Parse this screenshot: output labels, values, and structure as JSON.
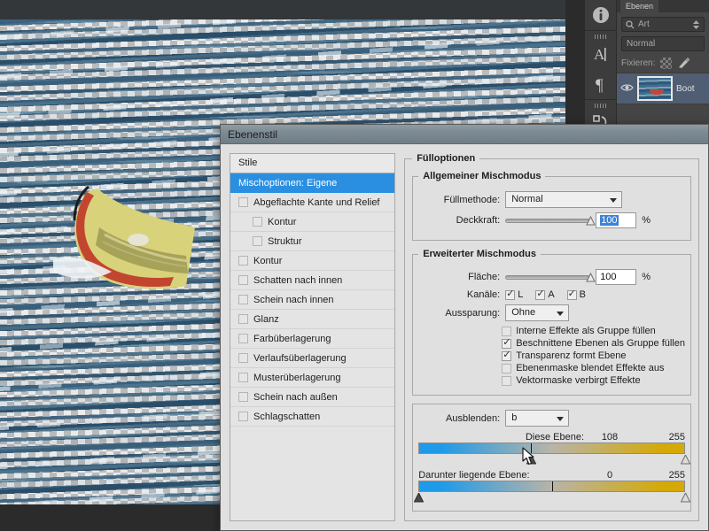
{
  "app": {
    "dock": {
      "panel_tab_label": "Ebenen",
      "search_placeholder": "Art",
      "blend_mode_value": "Normal",
      "lock_label": "Fixieren:",
      "layer_name": "Boot",
      "icons": {
        "info": "info-icon",
        "text_tool": "A",
        "paragraph": "¶",
        "search": "search-icon",
        "eye": "visibility-icon"
      }
    }
  },
  "dialog": {
    "title": "Ebenenstil",
    "styles": {
      "header": "Stile",
      "items": [
        {
          "label": "Mischoptionen: Eigene",
          "selected": true,
          "checkbox": false,
          "sub": false,
          "checked": false
        },
        {
          "label": "Abgeflachte Kante und Relief",
          "selected": false,
          "checkbox": true,
          "sub": false,
          "checked": false
        },
        {
          "label": "Kontur",
          "selected": false,
          "checkbox": true,
          "sub": true,
          "checked": false
        },
        {
          "label": "Struktur",
          "selected": false,
          "checkbox": true,
          "sub": true,
          "checked": false
        },
        {
          "label": "Kontur",
          "selected": false,
          "checkbox": true,
          "sub": false,
          "checked": false
        },
        {
          "label": "Schatten nach innen",
          "selected": false,
          "checkbox": true,
          "sub": false,
          "checked": false
        },
        {
          "label": "Schein nach innen",
          "selected": false,
          "checkbox": true,
          "sub": false,
          "checked": false
        },
        {
          "label": "Glanz",
          "selected": false,
          "checkbox": true,
          "sub": false,
          "checked": false
        },
        {
          "label": "Farbüberlagerung",
          "selected": false,
          "checkbox": true,
          "sub": false,
          "checked": false
        },
        {
          "label": "Verlaufsüberlagerung",
          "selected": false,
          "checkbox": true,
          "sub": false,
          "checked": false
        },
        {
          "label": "Musterüberlagerung",
          "selected": false,
          "checkbox": true,
          "sub": false,
          "checked": false
        },
        {
          "label": "Schein nach außen",
          "selected": false,
          "checkbox": true,
          "sub": false,
          "checked": false
        },
        {
          "label": "Schlagschatten",
          "selected": false,
          "checkbox": true,
          "sub": false,
          "checked": false
        }
      ]
    },
    "fill_options": {
      "legend": "Fülloptionen",
      "general": {
        "legend": "Allgemeiner Mischmodus",
        "blend_mode_label": "Füllmethode:",
        "blend_mode_value": "Normal",
        "opacity_label": "Deckkraft:",
        "opacity_value": "100",
        "opacity_unit": "%",
        "opacity_percent": 100
      },
      "advanced": {
        "legend": "Erweiterter Mischmodus",
        "fill_label": "Fläche:",
        "fill_value": "100",
        "fill_unit": "%",
        "fill_percent": 100,
        "channels_label": "Kanäle:",
        "channels": [
          {
            "label": "L",
            "checked": true
          },
          {
            "label": "A",
            "checked": true
          },
          {
            "label": "B",
            "checked": true
          }
        ],
        "knockout_label": "Aussparung:",
        "knockout_value": "Ohne",
        "checkboxes": [
          {
            "label": "Interne Effekte als Gruppe füllen",
            "checked": false
          },
          {
            "label": "Beschnittene Ebenen als Gruppe füllen",
            "checked": true
          },
          {
            "label": "Transparenz formt Ebene",
            "checked": true
          },
          {
            "label": "Ebenenmaske blendet Effekte aus",
            "checked": false
          },
          {
            "label": "Vektormaske verbirgt Effekte",
            "checked": false
          }
        ]
      },
      "blend_if": {
        "label": "Ausblenden:",
        "channel_value": "b",
        "this_layer": {
          "label": "Diese Ebene:",
          "min": "108",
          "max": "255",
          "min_pos_percent": 42,
          "max_pos_percent": 100
        },
        "underlying_layer": {
          "label": "Darunter liegende Ebene:",
          "min": "0",
          "max": "255",
          "min_pos_percent": 0,
          "max_pos_percent": 100
        },
        "gradient_start_color": "#1f9ae8",
        "gradient_mid_color": "#b8b4a8",
        "gradient_end_color": "#d4a908"
      }
    }
  }
}
